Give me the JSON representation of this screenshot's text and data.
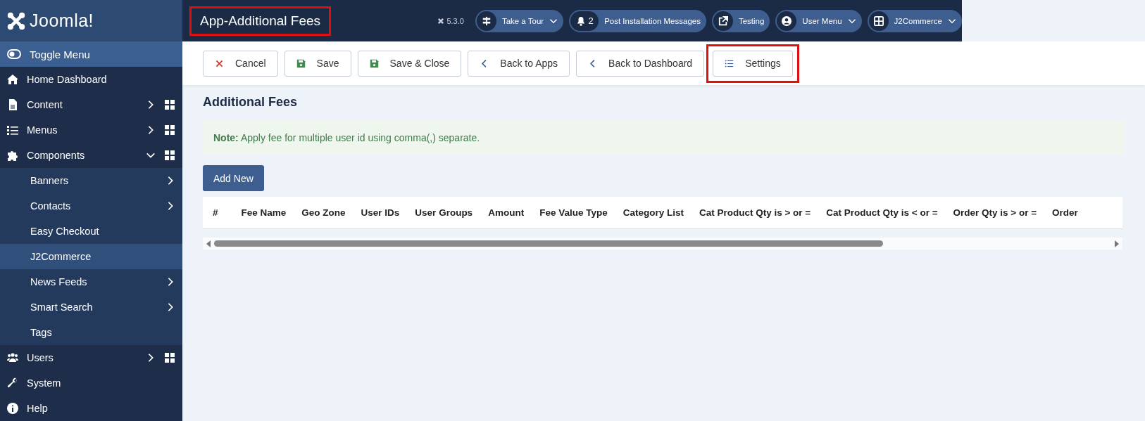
{
  "brand": {
    "name": "Joomla!"
  },
  "header": {
    "title": "App-Additional Fees",
    "title_highlighted": true,
    "version": "5.3.0",
    "pills": [
      {
        "label": "Take a Tour",
        "caret": true
      },
      {
        "label": "Post Installation Messages",
        "count": "2",
        "caret": false
      },
      {
        "label": "Testing",
        "caret": false
      },
      {
        "label": "User Menu",
        "caret": true
      },
      {
        "label": "J2Commerce",
        "caret": true
      }
    ]
  },
  "sidebar": {
    "toggle": {
      "label": "Toggle Menu"
    },
    "items": [
      {
        "label": "Home Dashboard",
        "selected": false
      },
      {
        "label": "Content",
        "selected": false,
        "expanded": false,
        "dashboard": true
      },
      {
        "label": "Menus",
        "selected": false,
        "expanded": false,
        "dashboard": true
      },
      {
        "label": "Components",
        "selected": false,
        "expanded": true,
        "dashboard": true,
        "children": [
          {
            "label": "Banners",
            "selected": false,
            "expanded": false
          },
          {
            "label": "Contacts",
            "selected": false,
            "expanded": false
          },
          {
            "label": "Easy Checkout",
            "selected": false
          },
          {
            "label": "J2Commerce",
            "selected": true
          },
          {
            "label": "News Feeds",
            "selected": false,
            "expanded": false
          },
          {
            "label": "Smart Search",
            "selected": false,
            "expanded": false
          },
          {
            "label": "Tags",
            "selected": false
          }
        ]
      },
      {
        "label": "Users",
        "selected": false,
        "expanded": false,
        "dashboard": true
      },
      {
        "label": "System",
        "selected": false
      },
      {
        "label": "Help",
        "selected": false
      }
    ]
  },
  "toolbar": [
    {
      "kind": "cancel",
      "label": "Cancel",
      "highlighted": false
    },
    {
      "kind": "save",
      "label": "Save",
      "highlighted": false
    },
    {
      "kind": "save",
      "label": "Save & Close",
      "highlighted": false
    },
    {
      "kind": "back",
      "label": "Back to Apps",
      "highlighted": false
    },
    {
      "kind": "back",
      "label": "Back to Dashboard",
      "highlighted": false
    },
    {
      "kind": "list",
      "label": "Settings",
      "highlighted": true
    }
  ],
  "content": {
    "heading": "Additional Fees",
    "note": "**Note:** Apply fee for multiple user id using comma(,) separate.",
    "add_button": "Add New",
    "table": {
      "columns": [
        "#",
        "Fee Name",
        "Geo Zone",
        "User IDs",
        "User Groups",
        "Amount",
        "Fee Value Type",
        "Category List",
        "Cat Product Qty is > or =",
        "Cat Product Qty is < or =",
        "Order Qty is > or =",
        "Order"
      ]
    }
  }
}
